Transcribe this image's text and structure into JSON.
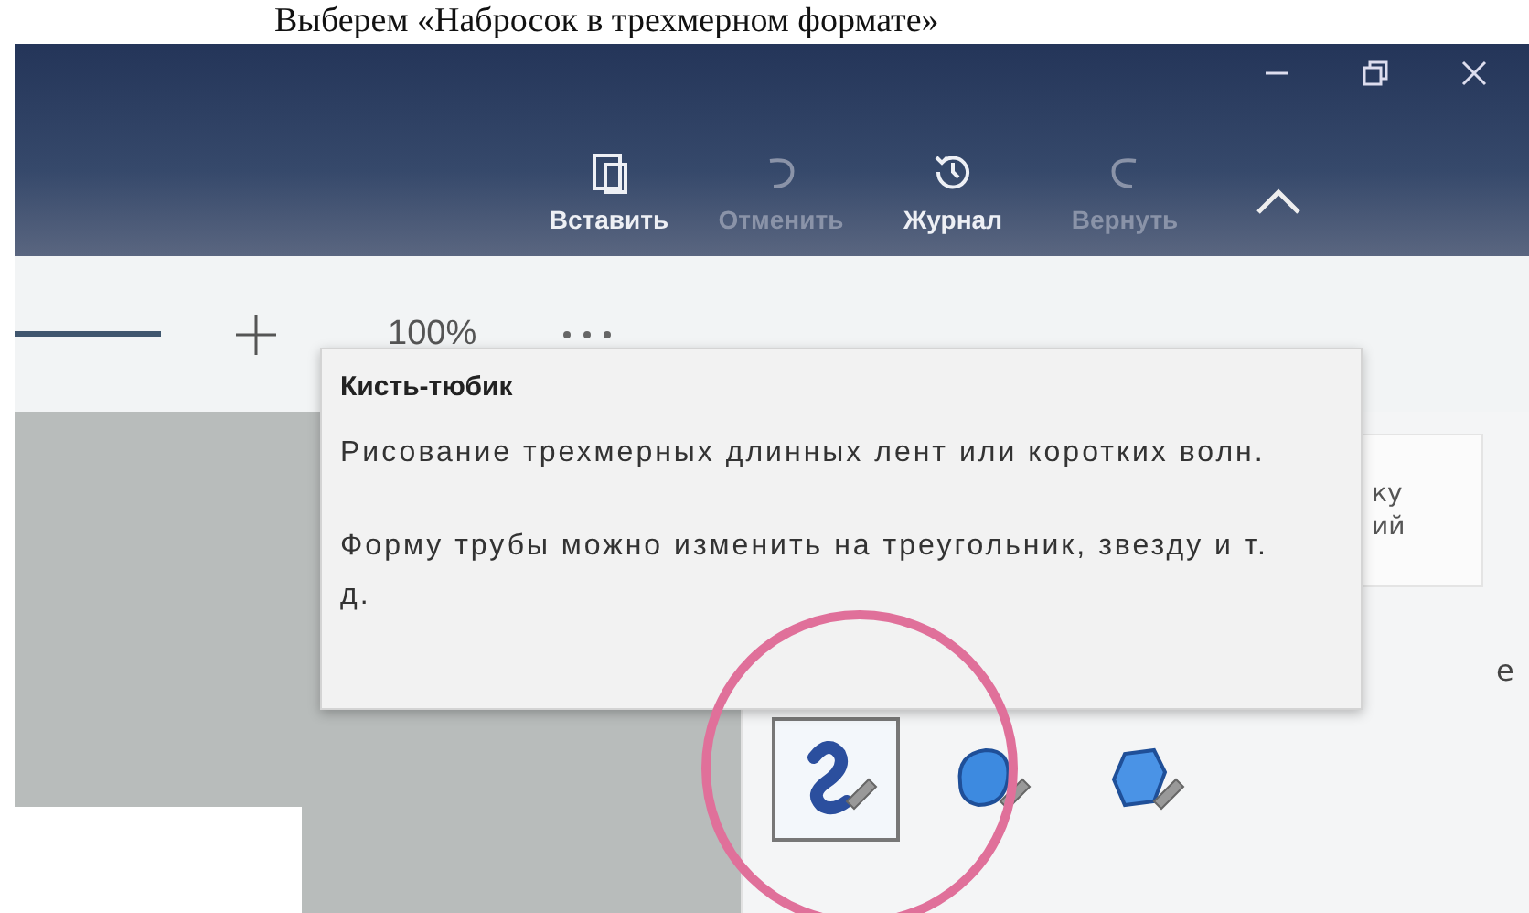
{
  "caption": "Выберем «Набросок в трехмерном формате»",
  "toolbar": {
    "buttons": [
      {
        "label": "Вставить",
        "disabled": false,
        "kind": "paste"
      },
      {
        "label": "Отменить",
        "disabled": true,
        "kind": "undo"
      },
      {
        "label": "Журнал",
        "disabled": false,
        "kind": "history"
      },
      {
        "label": "Вернуть",
        "disabled": true,
        "kind": "redo"
      }
    ]
  },
  "view_bar": {
    "zoom": "100%"
  },
  "panel": {
    "card_lines": [
      "ку",
      "ий"
    ],
    "label_fragment": "е"
  },
  "tooltip": {
    "title": "Кисть-тюбик",
    "paragraphs": [
      "Рисование трехмерных длинных лент или коротких волн.",
      "Форму трубы можно изменить на треугольник, звезду и т. д."
    ]
  },
  "brushes": [
    {
      "kind": "tube",
      "selected": true
    },
    {
      "kind": "blob",
      "selected": false
    },
    {
      "kind": "blob_sharp",
      "selected": false
    }
  ]
}
